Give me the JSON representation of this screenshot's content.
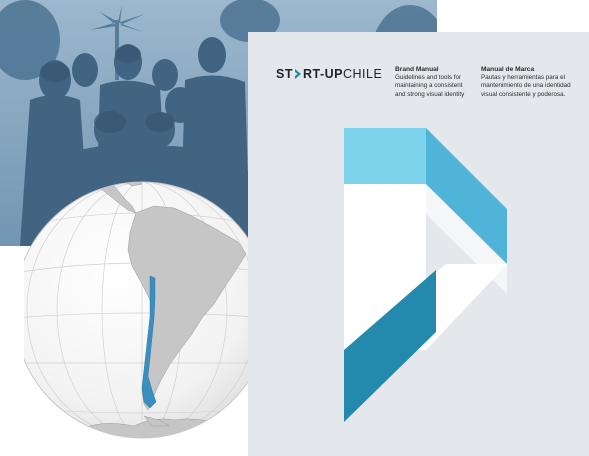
{
  "logo": {
    "part1": "ST",
    "part2": "RT-UP",
    "part3": "CHILE",
    "icon": "chevron-right-icon"
  },
  "english": {
    "heading": "Brand Manual",
    "lines": [
      "Guidelines and tools for",
      "maintaining a consistent",
      "and strong visual identity"
    ]
  },
  "spanish": {
    "heading": "Manual de Marca",
    "lines": [
      "Pautas y herramientas para el",
      "mantenimiento de una identidad",
      "visual consistente y poderosa."
    ]
  },
  "colors": {
    "photo_tint": "#7d9fbb",
    "globe_land": "#c6c6c6",
    "chile": "#3a8fc0",
    "cover_bg": "#e4e7eb",
    "light_blue": "#7dd3ec",
    "mid_blue": "#4fb4d8",
    "dark_blue": "#2389ad"
  }
}
